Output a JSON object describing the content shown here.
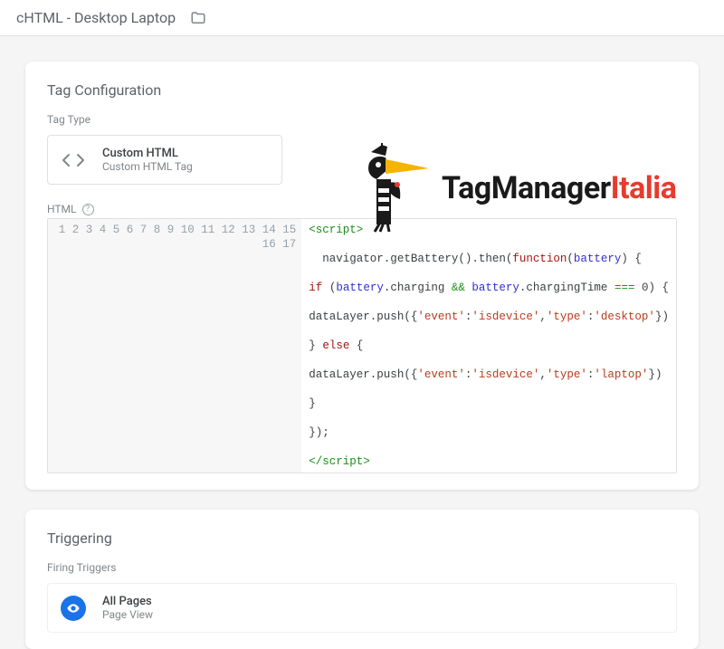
{
  "header": {
    "title": "cHTML - Desktop Laptop"
  },
  "config_card": {
    "title": "Tag Configuration",
    "type_label": "Tag Type",
    "type_name": "Custom HTML",
    "type_desc": "Custom HTML Tag",
    "html_label": "HTML"
  },
  "logo": {
    "part1": "TagManager",
    "part2": "Italia"
  },
  "code": {
    "lines": [
      {
        "n": "1",
        "t": [
          [
            "tag",
            "<script>"
          ]
        ]
      },
      {
        "n": "2",
        "t": []
      },
      {
        "n": "3",
        "t": [
          [
            "plain",
            "  navigator.getBattery().then("
          ],
          [
            "kw",
            "function"
          ],
          [
            "plain",
            "("
          ],
          [
            "var",
            "battery"
          ],
          [
            "plain",
            ") {"
          ]
        ]
      },
      {
        "n": "4",
        "t": []
      },
      {
        "n": "5",
        "t": [
          [
            "kw",
            "if"
          ],
          [
            "plain",
            " ("
          ],
          [
            "var",
            "battery"
          ],
          [
            "plain",
            ".charging "
          ],
          [
            "op",
            "&&"
          ],
          [
            "plain",
            " "
          ],
          [
            "var",
            "battery"
          ],
          [
            "plain",
            ".chargingTime "
          ],
          [
            "op",
            "==="
          ],
          [
            "plain",
            " "
          ],
          [
            "num",
            "0"
          ],
          [
            "plain",
            ") {"
          ]
        ]
      },
      {
        "n": "6",
        "t": []
      },
      {
        "n": "7",
        "t": [
          [
            "plain",
            "dataLayer.push({"
          ],
          [
            "str",
            "'event'"
          ],
          [
            "plain",
            ":"
          ],
          [
            "str",
            "'isdevice'"
          ],
          [
            "plain",
            ","
          ],
          [
            "str",
            "'type'"
          ],
          [
            "plain",
            ":"
          ],
          [
            "str",
            "'desktop'"
          ],
          [
            "plain",
            "})"
          ]
        ]
      },
      {
        "n": "8",
        "t": []
      },
      {
        "n": "9",
        "t": [
          [
            "plain",
            "} "
          ],
          [
            "kw",
            "else"
          ],
          [
            "plain",
            " {"
          ]
        ]
      },
      {
        "n": "10",
        "t": []
      },
      {
        "n": "11",
        "t": [
          [
            "plain",
            "dataLayer.push({"
          ],
          [
            "str",
            "'event'"
          ],
          [
            "plain",
            ":"
          ],
          [
            "str",
            "'isdevice'"
          ],
          [
            "plain",
            ","
          ],
          [
            "str",
            "'type'"
          ],
          [
            "plain",
            ":"
          ],
          [
            "str",
            "'laptop'"
          ],
          [
            "plain",
            "})"
          ]
        ]
      },
      {
        "n": "12",
        "t": []
      },
      {
        "n": "13",
        "t": [
          [
            "plain",
            "}"
          ]
        ]
      },
      {
        "n": "14",
        "t": []
      },
      {
        "n": "15",
        "t": [
          [
            "plain",
            "});"
          ]
        ]
      },
      {
        "n": "16",
        "t": []
      },
      {
        "n": "17",
        "t": [
          [
            "tag",
            "</script>"
          ]
        ]
      }
    ]
  },
  "trigger_card": {
    "title": "Triggering",
    "sub_label": "Firing Triggers",
    "trigger_name": "All Pages",
    "trigger_desc": "Page View"
  }
}
